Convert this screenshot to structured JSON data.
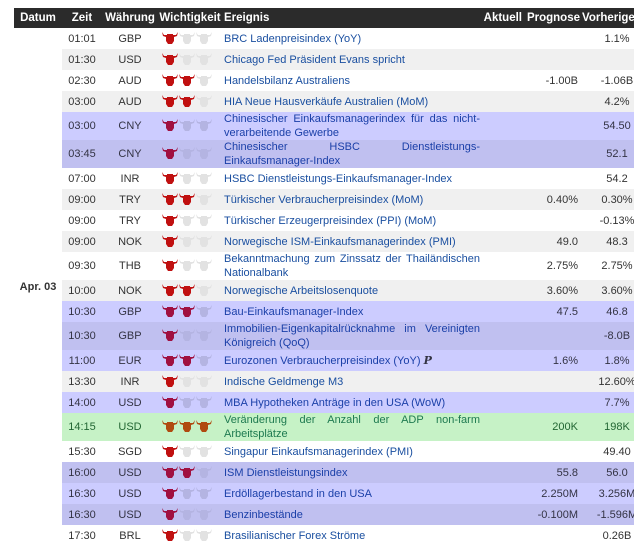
{
  "header": {
    "date": "Datum",
    "time": "Zeit",
    "currency": "Währung",
    "importance": "Wichtigkeit",
    "event": "Ereignis",
    "actual": "Aktuell",
    "forecast": "Prognose",
    "previous": "Vorherige"
  },
  "date_label": "Apr. 03",
  "colors": {
    "header_bg": "#2b2b2b",
    "highlight": "#ccccff",
    "highlight_alt": "#c0c0f0",
    "green": "#c6f2c6",
    "bull_active": "#c01010",
    "link": "#1a4fa0"
  },
  "rows": [
    {
      "time": "01:01",
      "cur": "GBP",
      "imp": 1,
      "event": "BRC Ladenpreisindex (YoY)",
      "actual": "",
      "forecast": "",
      "previous": "1.1%",
      "style": "z0"
    },
    {
      "time": "01:30",
      "cur": "USD",
      "imp": 1,
      "event": "Chicago Fed Präsident Evans spricht",
      "actual": "",
      "forecast": "",
      "previous": "",
      "style": "z1"
    },
    {
      "time": "02:30",
      "cur": "AUD",
      "imp": 2,
      "event": "Handelsbilanz Australiens",
      "actual": "",
      "forecast": "-1.00B",
      "previous": "-1.06B",
      "style": "z0"
    },
    {
      "time": "03:00",
      "cur": "AUD",
      "imp": 2,
      "event": "HIA Neue Hausverkäufe Australien (MoM)",
      "actual": "",
      "forecast": "",
      "previous": "4.2%",
      "style": "z1"
    },
    {
      "time": "03:00",
      "cur": "CNY",
      "imp": 1,
      "event": "Chinesischer Einkaufsmanagerindex für das nicht-verarbeitende Gewerbe",
      "actual": "",
      "forecast": "",
      "previous": "54.50",
      "style": "hl dbl"
    },
    {
      "time": "03:45",
      "cur": "CNY",
      "imp": 1,
      "event": "Chinesischer HSBC Dienstleistungs-Einkaufsmanager-Index",
      "actual": "",
      "forecast": "",
      "previous": "52.1",
      "style": "hl2 dbl"
    },
    {
      "time": "07:00",
      "cur": "INR",
      "imp": 1,
      "event": "HSBC Dienstleistungs-Einkaufsmanager-Index",
      "actual": "",
      "forecast": "",
      "previous": "54.2",
      "style": "z0"
    },
    {
      "time": "09:00",
      "cur": "TRY",
      "imp": 2,
      "event": "Türkischer Verbraucherpreisindex (MoM)",
      "actual": "",
      "forecast": "0.40%",
      "previous": "0.30%",
      "style": "z1"
    },
    {
      "time": "09:00",
      "cur": "TRY",
      "imp": 1,
      "event": "Türkischer Erzeugerpreisindex (PPI) (MoM)",
      "actual": "",
      "forecast": "",
      "previous": "-0.13%",
      "style": "z0"
    },
    {
      "time": "09:00",
      "cur": "NOK",
      "imp": 1,
      "event": "Norwegische ISM-Einkaufsmanagerindex (PMI)",
      "actual": "",
      "forecast": "49.0",
      "previous": "48.3",
      "style": "z1"
    },
    {
      "time": "09:30",
      "cur": "THB",
      "imp": 1,
      "event": "Bekanntmachung zum Zinssatz der Thailändischen Nationalbank",
      "actual": "",
      "forecast": "2.75%",
      "previous": "2.75%",
      "style": "z0 dbl"
    },
    {
      "time": "10:00",
      "cur": "NOK",
      "imp": 2,
      "event": "Norwegische Arbeitslosenquote",
      "actual": "",
      "forecast": "3.60%",
      "previous": "3.60%",
      "style": "z1"
    },
    {
      "time": "10:30",
      "cur": "GBP",
      "imp": 2,
      "event": "Bau-Einkaufsmanager-Index",
      "actual": "",
      "forecast": "47.5",
      "previous": "46.8",
      "style": "hl"
    },
    {
      "time": "10:30",
      "cur": "GBP",
      "imp": 1,
      "event": "Immobilien-Eigenkapitalrücknahme im Vereinigten Königreich (QoQ)",
      "actual": "",
      "forecast": "",
      "previous": "-8.0B",
      "style": "hl2 dbl"
    },
    {
      "time": "11:00",
      "cur": "EUR",
      "imp": 2,
      "event": "Eurozonen Verbraucherpreisindex (YoY)",
      "badge": "P",
      "actual": "",
      "forecast": "1.6%",
      "previous": "1.8%",
      "style": "hl"
    },
    {
      "time": "13:30",
      "cur": "INR",
      "imp": 1,
      "event": "Indische Geldmenge M3",
      "actual": "",
      "forecast": "",
      "previous": "12.60%",
      "style": "z1"
    },
    {
      "time": "14:00",
      "cur": "USD",
      "imp": 1,
      "event": "MBA Hypotheken Anträge in den USA (WoW)",
      "actual": "",
      "forecast": "",
      "previous": "7.7%",
      "style": "hl"
    },
    {
      "time": "14:15",
      "cur": "USD",
      "imp": 3,
      "event": "Veränderung der Anzahl der ADP non-farm Arbeitsplätze",
      "actual": "",
      "forecast": "200K",
      "previous": "198K",
      "style": "green dbl"
    },
    {
      "time": "15:30",
      "cur": "SGD",
      "imp": 1,
      "event": "Singapur Einkaufsmanagerindex (PMI)",
      "actual": "",
      "forecast": "",
      "previous": "49.40",
      "style": "z0"
    },
    {
      "time": "16:00",
      "cur": "USD",
      "imp": 2,
      "event": "ISM Dienstleistungsindex",
      "actual": "",
      "forecast": "55.8",
      "previous": "56.0",
      "style": "hl2"
    },
    {
      "time": "16:30",
      "cur": "USD",
      "imp": 1,
      "event": "Erdöllagerbestand in den USA",
      "actual": "",
      "forecast": "2.250M",
      "previous": "3.256M",
      "style": "hl"
    },
    {
      "time": "16:30",
      "cur": "USD",
      "imp": 1,
      "event": "Benzinbestände",
      "actual": "",
      "forecast": "-0.100M",
      "previous": "-1.596M",
      "style": "hl2"
    },
    {
      "time": "17:30",
      "cur": "BRL",
      "imp": 1,
      "event": "Brasilianischer Forex Ströme",
      "actual": "",
      "forecast": "",
      "previous": "0.26B",
      "style": "z0"
    }
  ]
}
